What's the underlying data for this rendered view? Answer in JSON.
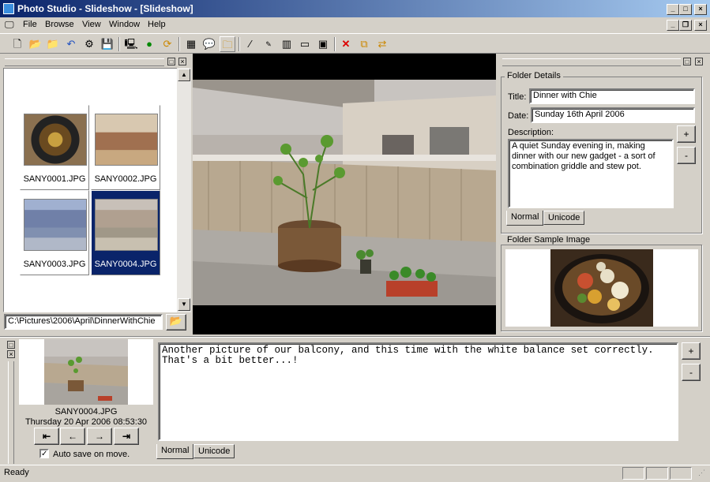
{
  "window": {
    "title": "Photo Studio - Slideshow - [Slideshow]"
  },
  "menu": [
    "File",
    "Browse",
    "View",
    "Window",
    "Help"
  ],
  "toolbar_icons": [
    "new-icon",
    "open-icon",
    "open-folder-icon",
    "undo-icon",
    "settings-icon",
    "save-icon",
    "properties-icon",
    "globe-icon",
    "refresh-icon",
    "grid-view-icon",
    "comment-icon",
    "folder-comment-icon",
    "wand-icon",
    "html-export-icon",
    "filmstrip-icon",
    "slideshow-icon",
    "fullscreen-icon",
    "delete-icon",
    "copy-icon",
    "move-icon"
  ],
  "thumbnails": [
    {
      "name": "SANY0001.JPG",
      "selected": false
    },
    {
      "name": "SANY0002.JPG",
      "selected": false
    },
    {
      "name": "SANY0003.JPG",
      "selected": false
    },
    {
      "name": "SANY0004.JPG",
      "selected": true
    }
  ],
  "path": {
    "value": "C:\\Pictures\\2006\\April\\DinnerWithChie"
  },
  "folder": {
    "group_label": "Folder Details",
    "title_label": "Title:",
    "title_value": "Dinner with Chie",
    "date_label": "Date:",
    "date_value": "Sunday 16th April 2006",
    "desc_label": "Description:",
    "desc_value": "A quiet Sunday evening in, making dinner with our new gadget - a sort of combination griddle and stew pot.",
    "plus": "+",
    "minus": "-",
    "tabs": [
      "Normal",
      "Unicode"
    ],
    "sample_label": "Folder Sample Image"
  },
  "current": {
    "filename": "SANY0004.JPG",
    "datetime": "Thursday 20 Apr 2006 08:53:30",
    "autosave_label": "Auto save on move.",
    "autosave_checked": true,
    "nav": [
      "first-icon",
      "prev-icon",
      "next-icon",
      "last-icon"
    ]
  },
  "caption": {
    "text": "Another picture of our balcony, and this time with the white balance set correctly. That's a bit better...!",
    "plus": "+",
    "minus": "-",
    "tabs": [
      "Normal",
      "Unicode"
    ]
  },
  "status": {
    "text": "Ready"
  }
}
